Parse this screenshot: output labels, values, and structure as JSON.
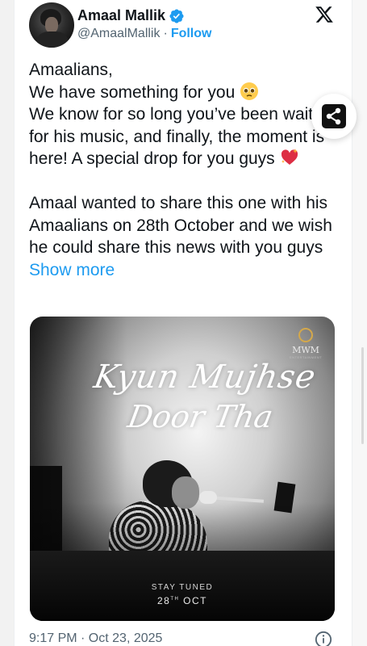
{
  "author": {
    "name": "Amaal Mallik",
    "handle": "@AmaalMallik",
    "separator": "·",
    "follow_label": "Follow"
  },
  "tweet": {
    "line1": "Amaalians,",
    "line2": "We have something for you",
    "line3": "We know for so long you’ve been waiting for his music, and finally, the moment is here! A special drop for you guys",
    "para2": "Amaal wanted to share this one with his Amaalians on 28th October and we wish he could share this news with you guys",
    "show_more_label": "Show more"
  },
  "poster": {
    "title_line1": "Kyun Mujhse",
    "title_line2": "Door Tha",
    "logo_name": "MWM",
    "logo_sub": "ENTERTAINMENT",
    "stay_tuned": "STAY TUNED",
    "date_day": "28",
    "date_suffix": "TH",
    "date_month": "OCT"
  },
  "timestamp": "9:17 PM · Oct 23, 2025",
  "icons": {
    "verified": "verified-badge-icon",
    "x": "x-logo-icon",
    "share": "share-icon",
    "info": "info-icon",
    "emoji1": "pleading-face-emoji",
    "emoji2": "sparkling-heart-emoji"
  },
  "colors": {
    "link": "#1d9bf0",
    "text": "#0f1419",
    "muted": "#536471"
  }
}
